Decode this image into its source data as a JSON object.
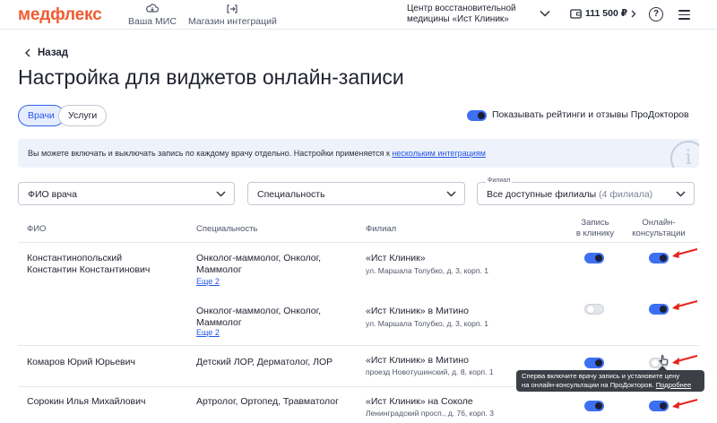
{
  "header": {
    "logo": "медфлекс",
    "nav": [
      {
        "label": "Ваша МИС",
        "icon": "cloud-icon"
      },
      {
        "label": "Магазин интеграций",
        "icon": "integration-icon"
      }
    ],
    "clinic_line1": "Центр восстановительной",
    "clinic_line2": "медицины «Ист Клиник»",
    "balance": "111 500 ₽",
    "help": "?"
  },
  "back_label": "Назад",
  "page_title": "Настройка для виджетов онлайн-записи",
  "tabs": [
    {
      "label": "Врачи",
      "active": true
    },
    {
      "label": "Услуги",
      "active": false
    }
  ],
  "ratings_toggle": {
    "label": "Показывать рейтинги и отзывы ПроДокторов",
    "on": true
  },
  "info": {
    "text": "Вы можете включать и выключать запись по каждому врачу отдельно. Настройки применяется к",
    "link": "нескольким интеграциям"
  },
  "filters": {
    "doctor": "ФИО врача",
    "specialty": "Специальность",
    "branch_label": "Филиал",
    "branch_value": "Все доступные филиалы",
    "branch_count": "(4 филиала)"
  },
  "table": {
    "headers": {
      "name": "ФИО",
      "specialty": "Специальность",
      "branch": "Филиал",
      "clinic_1": "Запись",
      "clinic_2": "в клинику",
      "online_1": "Онлайн-",
      "online_2": "консультации"
    },
    "rows": [
      {
        "name_1": "Константинопольский",
        "name_2": "Константин Константинович",
        "spec_1": "Онколог-маммолог, Онколог,",
        "spec_2": "Маммолог",
        "more": "Еще 2",
        "branch": "«Ист Клиник»",
        "address": "ул. Маршала Толубко, д. 3, корп. 1",
        "clinic_on": true,
        "online_on": true
      },
      {
        "spec_1": "Онколог-маммолог, Онколог,",
        "spec_2": "Маммолог",
        "more": "Еще 2",
        "branch": "«Ист Клиник» в Митино",
        "address": "ул. Маршала Толубко, д. 3, корп. 1",
        "clinic_on": false,
        "online_on": true
      },
      {
        "name_1": "Комаров Юрий Юрьевич",
        "spec_1": "Детский ЛОР, Дерматолог, ЛОР",
        "branch": "«Ист Клиник» в Митино",
        "address": "проезд Новотушинский, д. 8, корп. 1",
        "clinic_on": true,
        "online_on": false
      },
      {
        "name_1": "Сорокин Илья Михайлович",
        "spec_1": "Артролог, Ортопед, Травматолог",
        "branch": "«Ист Клиник» на Соколе",
        "address": "Ленинградский просп., д. 76, корп. 3",
        "clinic_on": true,
        "online_on": true
      }
    ]
  },
  "tooltip": {
    "line1": "Сперва включите врачу запись и установите цену",
    "line2": "на онлайн-консультации на ПроДокторов.",
    "link": "Подробнее"
  },
  "colors": {
    "brand": "#ef5b32",
    "accent": "#3d6ff3",
    "annotation": "#e8231d"
  }
}
